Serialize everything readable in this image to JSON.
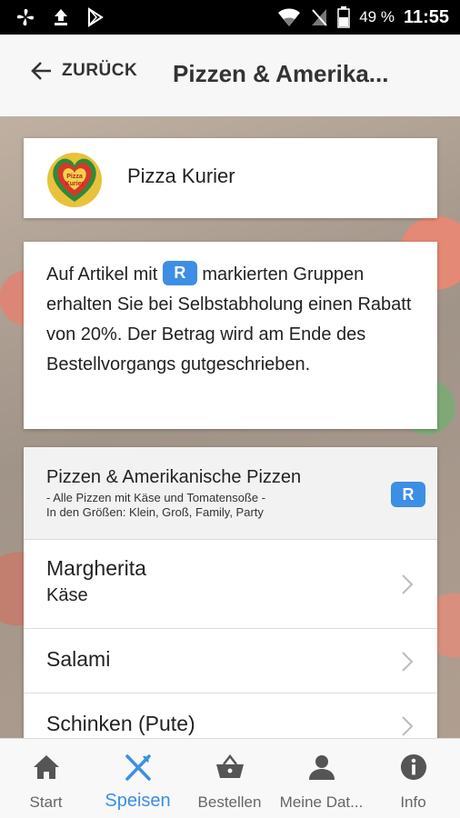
{
  "status_bar": {
    "battery": "49 %",
    "time": "11:55"
  },
  "app_bar": {
    "back_label": "ZURÜCK",
    "title": "Pizzen & Amerika..."
  },
  "shop": {
    "name": "Pizza Kurier",
    "logo_text": "Pizza Kurier"
  },
  "info": {
    "text_before": "Auf Artikel mit",
    "badge": "R",
    "text_after": "markierten Gruppen erhalten Sie bei Selbstabholung einen Rabatt von 20%. Der Betrag wird am Ende des Bestellvorgangs gutgeschrieben."
  },
  "group": {
    "title": "Pizzen & Amerikanische Pizzen",
    "subtitle_line1": "- Alle Pizzen mit Käse und Tomatensoße -",
    "subtitle_line2": "In den Größen: Klein, Groß, Family, Party",
    "badge": "R"
  },
  "items": [
    {
      "name": "Margherita",
      "description": "Käse"
    },
    {
      "name": "Salami",
      "description": ""
    },
    {
      "name": "Schinken (Pute)",
      "description": ""
    }
  ],
  "nav": [
    {
      "label": "Start",
      "icon": "home-icon"
    },
    {
      "label": "Speisen",
      "icon": "fork-knife-icon"
    },
    {
      "label": "Bestellen",
      "icon": "basket-icon"
    },
    {
      "label": "Meine Dat...",
      "icon": "person-icon"
    },
    {
      "label": "Info",
      "icon": "info-icon"
    }
  ],
  "colors": {
    "accent": "#3d8ee5",
    "badge_text": "#ffffff"
  }
}
